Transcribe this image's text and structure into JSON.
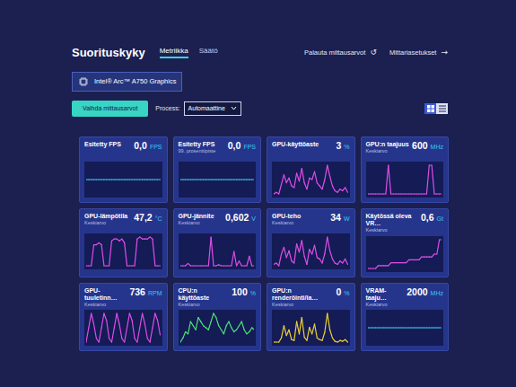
{
  "header": {
    "title": "Suorituskyky",
    "tabs": [
      {
        "label": "Metriikka",
        "selected": true
      },
      {
        "label": "Säätö",
        "selected": false
      }
    ],
    "actions": [
      {
        "label": "Palauta mittausarvot",
        "icon": "↺"
      },
      {
        "label": "Mittariasetukset",
        "icon": "→"
      }
    ]
  },
  "gpu_selector": {
    "label": "Intel® Arc™ A750 Graphics"
  },
  "toolbar": {
    "button": "Vaihda mittausarvot",
    "process_label": "Process:",
    "process_value": "Automaattine",
    "view_modes": [
      {
        "kind": "grid",
        "selected": true
      },
      {
        "kind": "list",
        "selected": false
      }
    ]
  },
  "cards": [
    {
      "title": "Esitetty FPS",
      "value": "0,0",
      "unit": "FPS",
      "color": "#38c8f0",
      "values": [
        0,
        0,
        0,
        0,
        0,
        0,
        0,
        0,
        0,
        0,
        0,
        0,
        0,
        0,
        0,
        0,
        0,
        0,
        0,
        0,
        0,
        0,
        0,
        0,
        0,
        0,
        0,
        0,
        0,
        0
      ]
    },
    {
      "title": "Esitetty FPS",
      "subtitle": "99. prosenttipiste",
      "value": "0,0",
      "unit": "FPS",
      "color": "#38c8f0",
      "values": [
        0,
        0,
        0,
        0,
        0,
        0,
        0,
        0,
        0,
        0,
        0,
        0,
        0,
        0,
        0,
        0,
        0,
        0,
        0,
        0,
        0,
        0,
        0,
        0,
        0,
        0,
        0,
        0,
        0,
        0
      ]
    },
    {
      "title": "GPU-käyttöaste",
      "value": "3",
      "unit": "%",
      "color": "#e04ee8",
      "values": [
        2,
        3,
        2,
        8,
        14,
        9,
        12,
        7,
        6,
        15,
        10,
        18,
        9,
        5,
        12,
        11,
        16,
        9,
        7,
        5,
        11,
        20,
        13,
        7,
        4,
        3,
        5,
        4,
        6,
        3
      ]
    },
    {
      "title": "GPU:n taajuus",
      "subtitle": "Keskiarvo",
      "value": "600",
      "unit": "MHz",
      "color": "#e04ee8",
      "values": [
        600,
        600,
        600,
        600,
        600,
        600,
        600,
        600,
        2400,
        600,
        600,
        600,
        600,
        600,
        600,
        600,
        600,
        600,
        600,
        600,
        600,
        600,
        600,
        600,
        2400,
        2400,
        600,
        600,
        600,
        600
      ]
    },
    {
      "title": "GPU-lämpötila",
      "subtitle": "Keskiarvo",
      "value": "47,2",
      "unit": "°C",
      "color": "#e04ee8",
      "values": [
        41,
        41,
        41,
        52,
        52,
        53,
        52,
        41,
        41,
        41,
        54,
        55,
        55,
        54,
        55,
        53,
        41,
        41,
        41,
        41,
        55,
        56,
        55,
        55,
        55,
        56,
        55,
        41,
        41,
        41
      ]
    },
    {
      "title": "GPU-jännite",
      "subtitle": "Keskiarvo",
      "value": "0,602",
      "unit": "V",
      "color": "#e04ee8",
      "values": [
        0.3,
        0.3,
        0.3,
        0.35,
        0.3,
        0.3,
        0.3,
        0.3,
        0.3,
        0.3,
        0.3,
        0.3,
        0.9,
        0.3,
        0.3,
        0.32,
        0.3,
        0.3,
        0.3,
        0.3,
        0.3,
        0.6,
        0.3,
        0.4,
        0.3,
        0.3,
        0.3,
        0.5,
        0.3,
        0.3
      ]
    },
    {
      "title": "GPU-teho",
      "subtitle": "Keskiarvo",
      "value": "34",
      "unit": "W",
      "color": "#e04ee8",
      "values": [
        20,
        22,
        18,
        35,
        45,
        30,
        40,
        25,
        22,
        50,
        38,
        55,
        32,
        20,
        42,
        35,
        48,
        30,
        28,
        22,
        36,
        60,
        40,
        28,
        22,
        20,
        25,
        22,
        28,
        20
      ]
    },
    {
      "title": "Käytössä oleva VR…",
      "subtitle": "Keskiarvo",
      "value": "0,6",
      "unit": "Gt",
      "color": "#e04ee8",
      "values": [
        0.4,
        0.4,
        0.4,
        0.4,
        0.45,
        0.45,
        0.45,
        0.45,
        0.45,
        0.5,
        0.5,
        0.5,
        0.5,
        0.5,
        0.5,
        0.5,
        0.55,
        0.55,
        0.55,
        0.55,
        0.55,
        0.6,
        0.6,
        0.6,
        0.6,
        0.6,
        0.65,
        0.65,
        0.9,
        0.9
      ]
    },
    {
      "title": "GPU-tuuletinn…",
      "subtitle": "Keskiarvo",
      "value": "736",
      "unit": "RPM",
      "color": "#e04ee8",
      "values": [
        500,
        900,
        1300,
        1000,
        600,
        500,
        900,
        1300,
        1100,
        600,
        500,
        900,
        1300,
        1000,
        600,
        500,
        900,
        1300,
        1100,
        600,
        500,
        900,
        1300,
        1000,
        600,
        500,
        900,
        1300,
        1100,
        700
      ]
    },
    {
      "title": "CPU:n käyttöaste",
      "subtitle": "Keskiarvo",
      "value": "100",
      "unit": "%",
      "color": "#4ee07a",
      "values": [
        20,
        22,
        25,
        24,
        30,
        28,
        26,
        32,
        30,
        28,
        27,
        26,
        30,
        34,
        32,
        28,
        26,
        24,
        28,
        30,
        27,
        25,
        26,
        28,
        30,
        26,
        24,
        25,
        27,
        26
      ]
    },
    {
      "title": "GPU:n renderöinti/la…",
      "subtitle": "Keskiarvo",
      "value": "0",
      "unit": "%",
      "color": "#f0d030",
      "values": [
        0,
        0,
        0,
        5,
        20,
        8,
        15,
        3,
        2,
        25,
        10,
        30,
        6,
        2,
        18,
        10,
        22,
        5,
        3,
        2,
        12,
        35,
        15,
        5,
        1,
        0,
        2,
        1,
        3,
        0
      ]
    },
    {
      "title": "VRAM-taaju…",
      "subtitle": "Keskiarvo",
      "value": "2000",
      "unit": "MHz",
      "color": "#38c8f0",
      "values": [
        2000,
        2000,
        2000,
        2000,
        2000,
        2000,
        2000,
        2000,
        2000,
        2000,
        2000,
        2000,
        2000,
        2000,
        2000,
        2000,
        2000,
        2000,
        2000,
        2000,
        2000,
        2000,
        2000,
        2000,
        2000,
        2000,
        2000,
        2000,
        2000,
        2000
      ]
    }
  ]
}
